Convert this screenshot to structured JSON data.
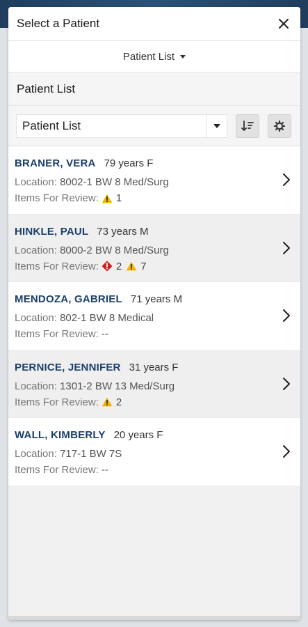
{
  "modal": {
    "title": "Select a Patient",
    "list_selector_label": "Patient List",
    "section_title": "Patient List"
  },
  "controls": {
    "select_value": "Patient List"
  },
  "labels": {
    "location": "Location:",
    "items_for_review": "Items For Review:"
  },
  "patients": [
    {
      "name": "BRANER, VERA",
      "age_sex": "79 years F",
      "location": "8002-1 BW 8 Med/Surg",
      "review_alerts": null,
      "review_warnings": "1",
      "review_text": ""
    },
    {
      "name": "HINKLE, PAUL",
      "age_sex": "73 years M",
      "location": "8000-2 BW 8 Med/Surg",
      "review_alerts": "2",
      "review_warnings": "7",
      "review_text": ""
    },
    {
      "name": "MENDOZA, GABRIEL",
      "age_sex": "71 years M",
      "location": "802-1 BW 8 Medical",
      "review_alerts": null,
      "review_warnings": null,
      "review_text": "--"
    },
    {
      "name": "PERNICE, JENNIFER",
      "age_sex": "31 years F",
      "location": "1301-2 BW 13 Med/Surg",
      "review_alerts": null,
      "review_warnings": "2",
      "review_text": ""
    },
    {
      "name": "WALL, KIMBERLY",
      "age_sex": "20 years F",
      "location": "717-1 BW 7S",
      "review_alerts": null,
      "review_warnings": null,
      "review_text": "--"
    }
  ],
  "colors": {
    "name_blue": "#1b3f6b",
    "warning_yellow": "#f2b300",
    "alert_red": "#cc1f1f"
  }
}
